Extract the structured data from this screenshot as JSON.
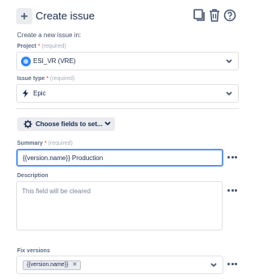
{
  "header": {
    "title": "Create issue",
    "icons": [
      "plus-icon",
      "copy-icon",
      "trash-icon",
      "help-icon"
    ]
  },
  "subtitle": "Create a new issue in:",
  "project": {
    "label": "Project",
    "required_mark": "*",
    "required_text": "(required)",
    "value": "ESI_VR (VRE)"
  },
  "issue_type": {
    "label": "Issue type",
    "required_mark": "*",
    "required_text": "(required)",
    "value": "Epic"
  },
  "choose_fields": {
    "label": "Choose fields to set..."
  },
  "summary": {
    "label": "Summary",
    "required_mark": "*",
    "required_text": "(required)",
    "value": "{{version.name}} Production"
  },
  "description": {
    "label": "Description",
    "placeholder": "This field will be cleared"
  },
  "fix_versions": {
    "label": "Fix versions",
    "chips": [
      "{{version.name}}"
    ]
  },
  "colors": {
    "focus": "#4c9aff",
    "project_icon": "#2684ff",
    "required": "#de350b"
  }
}
